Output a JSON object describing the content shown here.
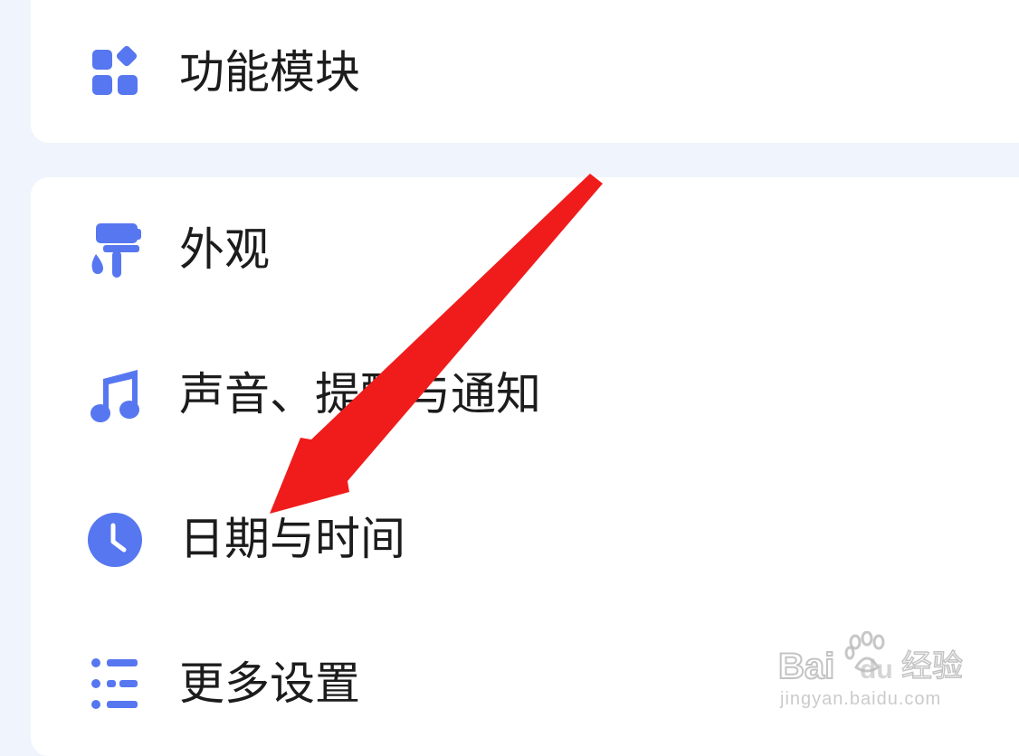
{
  "menu": {
    "top_item": {
      "label": "功能模块",
      "icon": "grid-modules-icon"
    },
    "items": [
      {
        "label": "外观",
        "icon": "paint-roller-icon"
      },
      {
        "label": "声音、提醒与通知",
        "icon": "music-note-icon"
      },
      {
        "label": "日期与时间",
        "icon": "clock-icon"
      },
      {
        "label": "更多设置",
        "icon": "list-settings-icon"
      }
    ]
  },
  "colors": {
    "accent": "#5677f0",
    "arrow": "#f01c1c",
    "background": "#f0f4fc",
    "card": "#ffffff",
    "text": "#1c1c1c"
  },
  "watermark": {
    "brand": "Baidu经验",
    "url": "jingyan.baidu.com"
  }
}
